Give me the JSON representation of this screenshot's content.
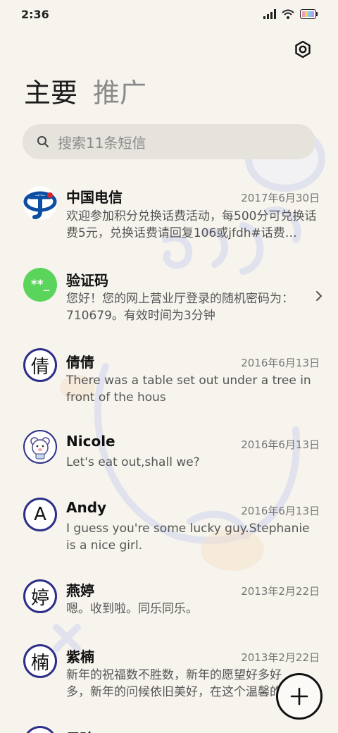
{
  "status": {
    "time": "2:36",
    "icons": [
      "signal-icon",
      "wifi-icon",
      "battery-icon"
    ]
  },
  "tabs": [
    {
      "label": "主要"
    },
    {
      "label": "推广"
    }
  ],
  "search": {
    "placeholder": "搜索11条短信"
  },
  "conversations": [
    {
      "name": "中国电信",
      "date": "2017年6月30日",
      "preview": "欢迎参加积分兑换话费活动，每500分可兑换话费5元，兑换话费请回复106或jfdh#话费…",
      "avatar": "telecom-logo"
    },
    {
      "name": "验证码",
      "date": "",
      "preview": "您好！您的网上营业厅登录的随机密码为：710679。有效时间为3分钟",
      "avatar": "**_"
    },
    {
      "name": "倩倩",
      "date": "2016年6月13日",
      "preview": "There was a table set out under a tree in front of the hous",
      "avatar": "倩"
    },
    {
      "name": "Nicole",
      "date": "2016年6月13日",
      "preview": "Let's eat out,shall we?",
      "avatar": "bear-avatar"
    },
    {
      "name": "Andy",
      "date": "2016年6月13日",
      "preview": "I guess you're some lucky guy.Stephanie is a nice girl.",
      "avatar": "A"
    },
    {
      "name": "燕婷",
      "date": "2013年2月22日",
      "preview": "嗯。收到啦。同乐同乐。",
      "avatar": "婷"
    },
    {
      "name": "紫楠",
      "date": "2013年2月22日",
      "preview": "新年的祝福数不胜数，新年的愿望好多好多，新年的问候依旧美好，在这个温馨的时刻",
      "avatar": "楠"
    },
    {
      "name": "子玲",
      "date": "",
      "preview": "",
      "avatar": ""
    }
  ],
  "colors": {
    "accent_ring": "#2c2f87",
    "verify_green": "#5bd45b",
    "telecom_blue": "#0b4ea2",
    "telecom_red": "#d8232a"
  }
}
